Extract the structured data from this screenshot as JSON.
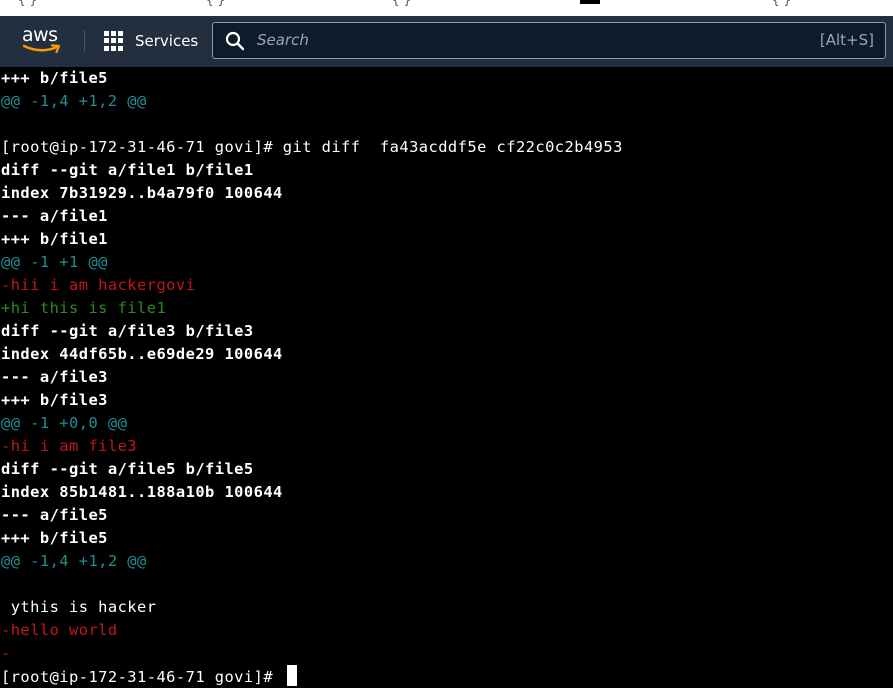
{
  "aws_header": {
    "logo_text": "aws",
    "services_label": "Services",
    "search": {
      "placeholder": "Search",
      "shortcut": "[Alt+S]"
    },
    "colors": {
      "bar": "#232f3e",
      "smile": "#ff9900"
    }
  },
  "terminal": {
    "lines": [
      {
        "text": "+++ b/file5",
        "style": "bold"
      },
      {
        "text": "@@ -1,4 +1,2 @@",
        "style": "cyan"
      },
      {
        "text": "",
        "style": "normal"
      },
      {
        "text": "[root@ip-172-31-46-71 govi]# git diff  fa43acddf5e cf22c0c2b4953",
        "style": "normal"
      },
      {
        "text": "diff --git a/file1 b/file1",
        "style": "bold"
      },
      {
        "text": "index 7b31929..b4a79f0 100644",
        "style": "bold"
      },
      {
        "text": "--- a/file1",
        "style": "bold"
      },
      {
        "text": "+++ b/file1",
        "style": "bold"
      },
      {
        "text": "@@ -1 +1 @@",
        "style": "cyan"
      },
      {
        "text": "-hii i am hackergovi",
        "style": "red"
      },
      {
        "text": "+hi this is file1",
        "style": "green"
      },
      {
        "text": "diff --git a/file3 b/file3",
        "style": "bold"
      },
      {
        "text": "index 44df65b..e69de29 100644",
        "style": "bold"
      },
      {
        "text": "--- a/file3",
        "style": "bold"
      },
      {
        "text": "+++ b/file3",
        "style": "bold"
      },
      {
        "text": "@@ -1 +0,0 @@",
        "style": "cyan"
      },
      {
        "text": "-hi i am file3",
        "style": "red"
      },
      {
        "text": "diff --git a/file5 b/file5",
        "style": "bold"
      },
      {
        "text": "index 85b1481..188a10b 100644",
        "style": "bold"
      },
      {
        "text": "--- a/file5",
        "style": "bold"
      },
      {
        "text": "+++ b/file5",
        "style": "bold"
      },
      {
        "text": "@@ -1,4 +1,2 @@",
        "style": "cyan"
      },
      {
        "text": "",
        "style": "normal"
      },
      {
        "text": " ythis is hacker",
        "style": "normal"
      },
      {
        "text": "-hello world",
        "style": "red"
      },
      {
        "text": "-",
        "style": "red"
      }
    ],
    "prompt": "[root@ip-172-31-46-71 govi]# ",
    "colors": {
      "background": "#000000",
      "text": "#ffffff",
      "hunk": "#1e8f97",
      "removed": "#c2161b",
      "added": "#2e8b1f"
    }
  }
}
